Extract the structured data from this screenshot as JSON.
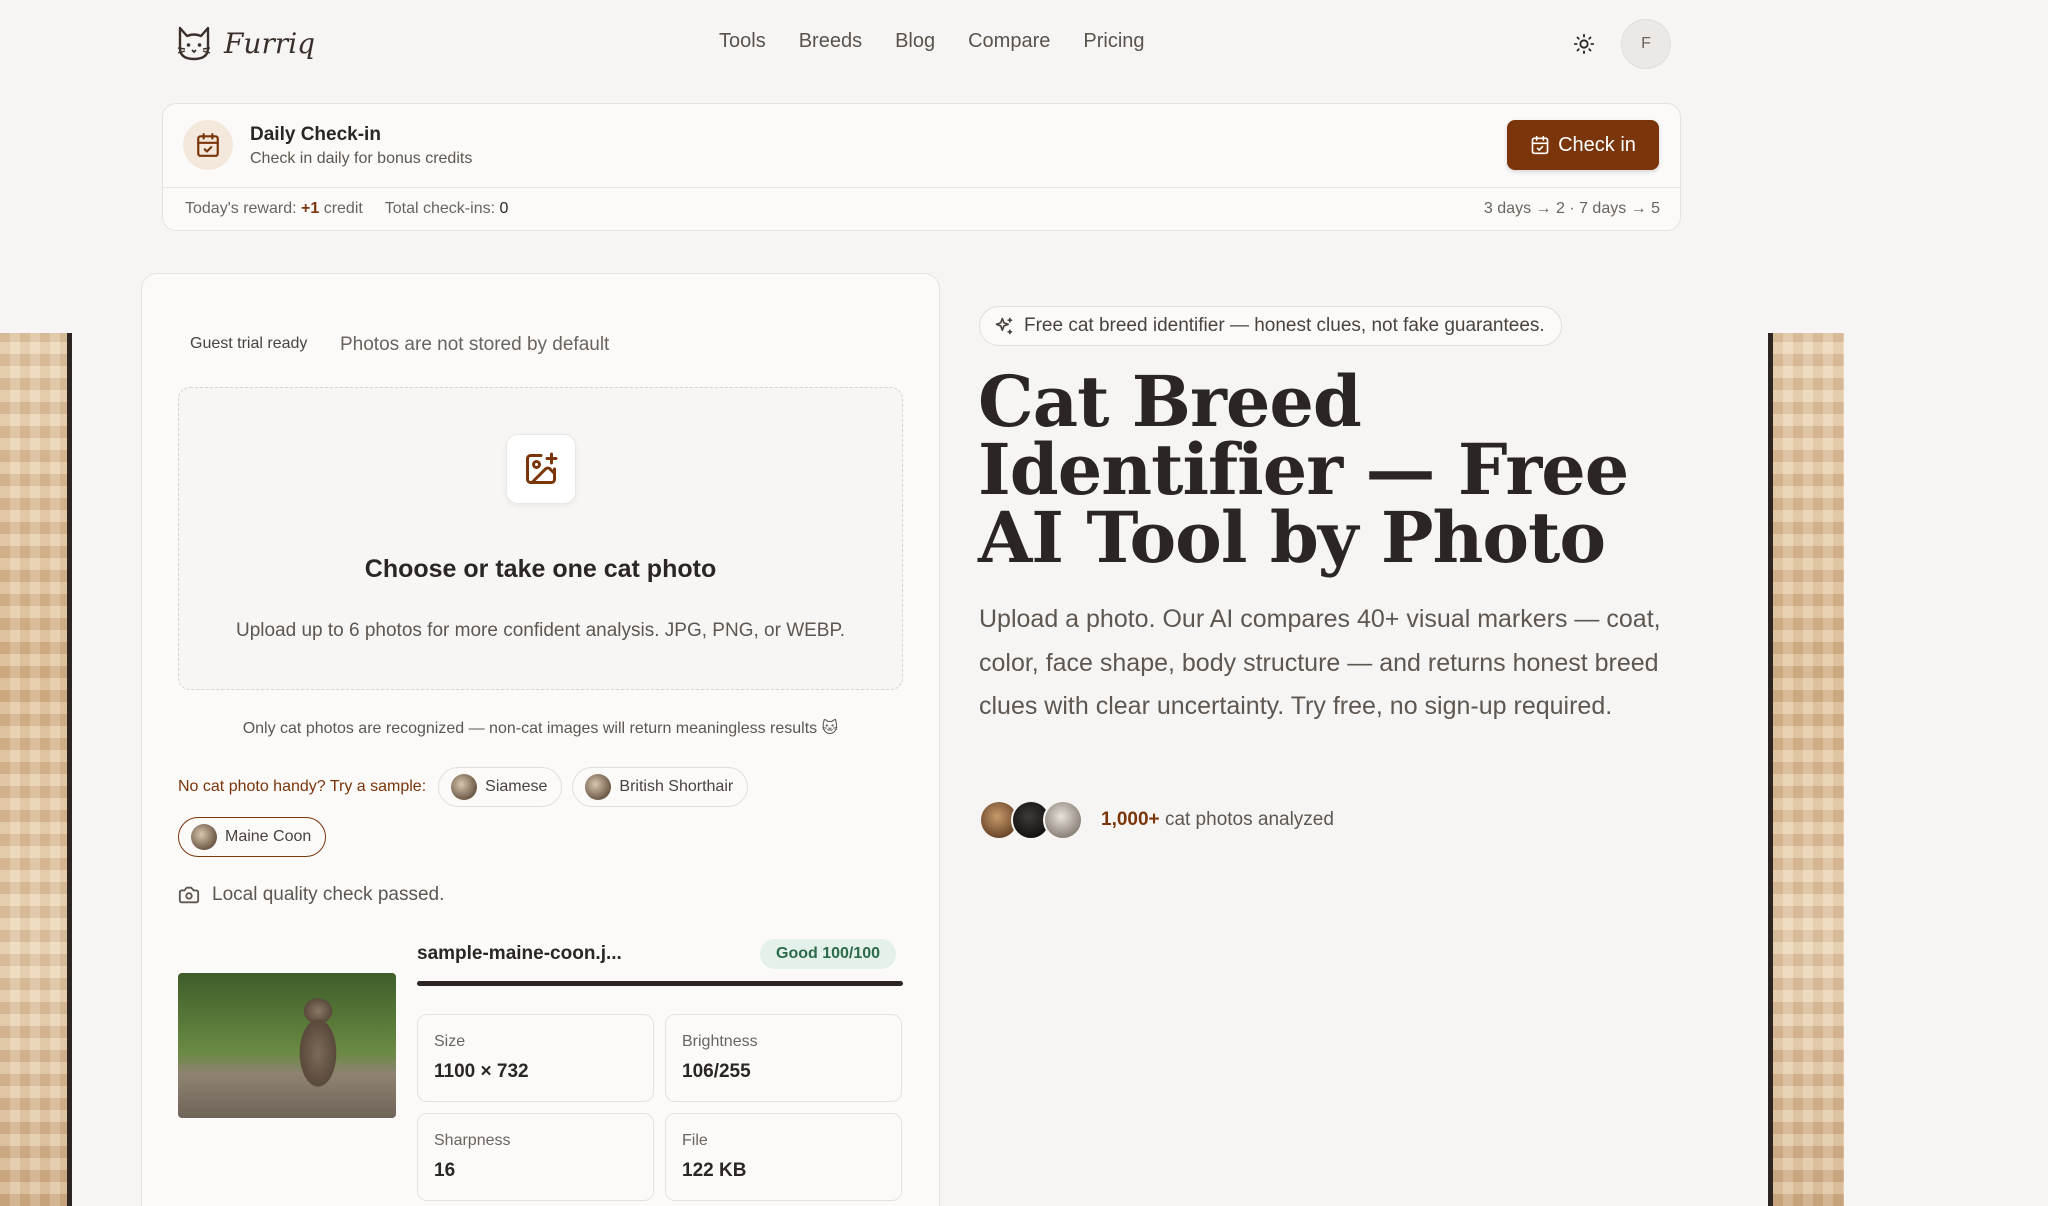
{
  "header": {
    "brand": "Furriq",
    "nav": [
      "Tools",
      "Breeds",
      "Blog",
      "Compare",
      "Pricing"
    ],
    "avatar_initial": "F"
  },
  "checkin": {
    "title": "Daily Check-in",
    "subtitle": "Check in daily for bonus credits",
    "button_label": "Check in",
    "reward_label": "Today's reward:",
    "reward_value": "+1",
    "reward_unit": "credit",
    "total_label": "Total check-ins:",
    "total_value": "0",
    "streak_info": "3 days → 2 · 7 days → 5"
  },
  "upload": {
    "guest_badge": "Guest trial ready",
    "privacy_note": "Photos are not stored by default",
    "dropzone_title": "Choose or take one cat photo",
    "dropzone_subtitle": "Upload up to 6 photos for more confident analysis. JPG, PNG, or WEBP.",
    "only_cat_note": "Only cat photos are recognized — non-cat images will return meaningless results 🐱",
    "sample_label": "No cat photo handy? Try a sample:",
    "samples": [
      "Siamese",
      "British Shorthair",
      "Maine Coon"
    ],
    "quality_note": "Local quality check passed.",
    "file_name": "sample-maine-coon.j...",
    "quality_badge": "Good 100/100",
    "quality_score": 100,
    "stats": [
      {
        "label": "Size",
        "value": "1100 × 732"
      },
      {
        "label": "Brightness",
        "value": "106/255"
      },
      {
        "label": "Sharpness",
        "value": "16"
      },
      {
        "label": "File",
        "value": "122 KB"
      }
    ]
  },
  "hero": {
    "pill": "Free cat breed identifier — honest clues, not fake guarantees.",
    "title": "Cat Breed Identifier — Free AI Tool by Photo",
    "description": "Upload a photo. Our AI compares 40+ visual markers — coat, color, face shape, body structure — and returns honest breed clues with clear uncertainty. Try free, no sign-up required.",
    "social_count": "1,000+",
    "social_text": "cat photos analyzed"
  },
  "colors": {
    "accent": "#7a350a",
    "background": "#f7f5f3",
    "success_bg": "#e4f1ea",
    "success_text": "#2d6a4a"
  },
  "icons": [
    "cat-logo-icon",
    "sun-icon",
    "calendar-check-icon",
    "image-plus-icon",
    "sparkles-icon",
    "camera-icon"
  ]
}
